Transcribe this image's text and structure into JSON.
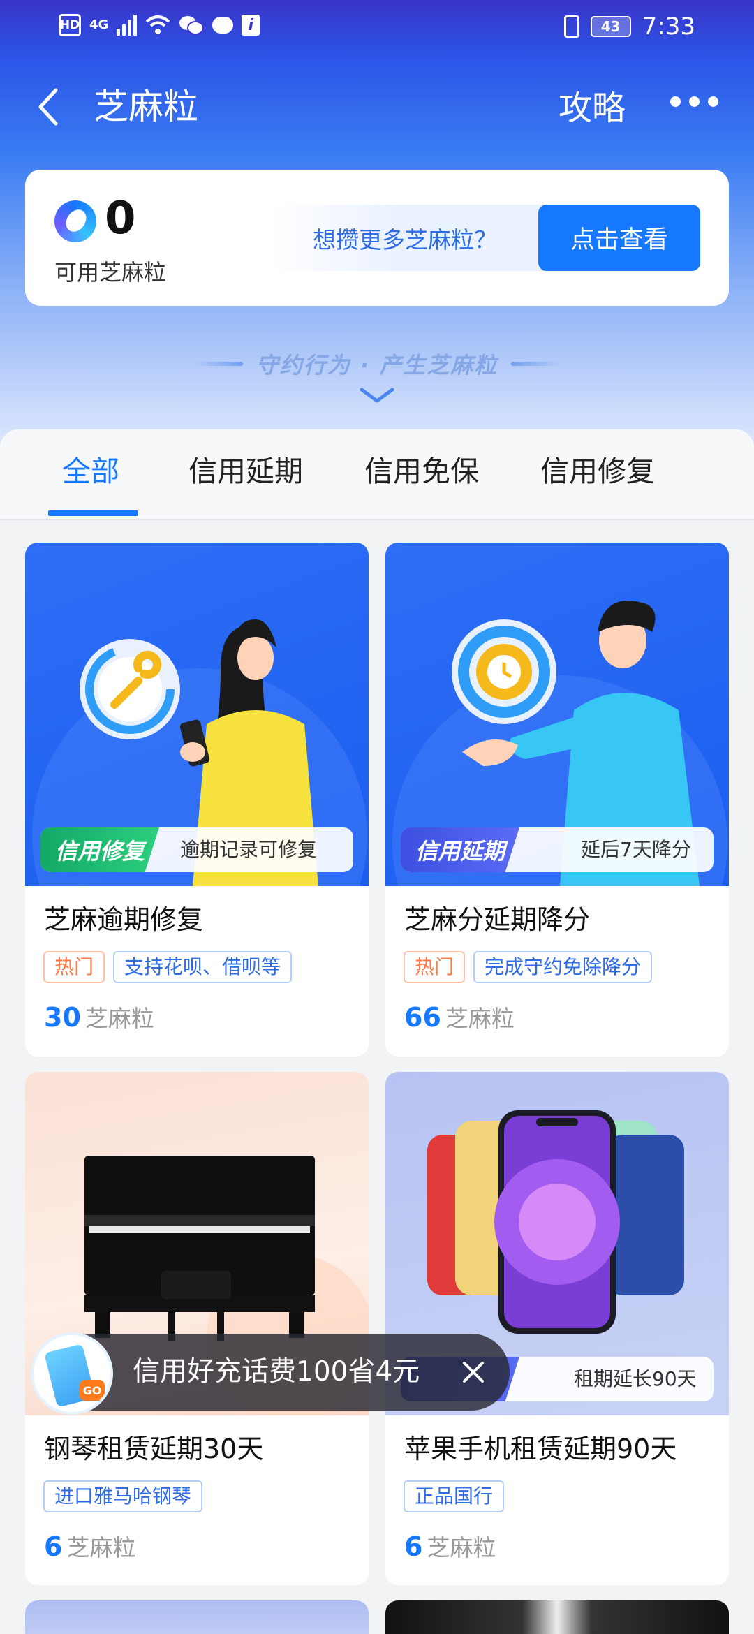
{
  "status_bar": {
    "hd": "HD",
    "network": "4G",
    "battery": "43",
    "time": "7:33",
    "icons": [
      "hd-icon",
      "signal-icon",
      "wifi-icon",
      "wechat-icon",
      "message-icon",
      "info-icon",
      "vibrate-icon",
      "battery-icon"
    ]
  },
  "nav": {
    "back_icon": "chevron-left-icon",
    "title": "芝麻粒",
    "guide": "攻略",
    "more_icon": "more-dots-icon"
  },
  "points_card": {
    "value": "0",
    "label": "可用芝麻粒",
    "promo_text": "想攒更多芝麻粒？",
    "button": "点击查看"
  },
  "slogan": "守约行为 · 产生芝麻粒",
  "tabs": [
    {
      "label": "全部",
      "active": true
    },
    {
      "label": "信用延期",
      "active": false
    },
    {
      "label": "信用免保",
      "active": false
    },
    {
      "label": "信用修复",
      "active": false
    }
  ],
  "cards": [
    {
      "banner_tag": "信用修复",
      "banner_text": "逾期记录可修复",
      "title": "芝麻逾期修复",
      "tags": [
        "热门",
        "支持花呗、借呗等"
      ],
      "points": "30",
      "unit": "芝麻粒"
    },
    {
      "banner_tag": "信用延期",
      "banner_text": "延后7天降分",
      "title": "芝麻分延期降分",
      "tags": [
        "热门",
        "完成守约免除降分"
      ],
      "points": "66",
      "unit": "芝麻粒"
    },
    {
      "title": "钢琴租赁延期30天",
      "tags": [
        "进口雅马哈钢琴"
      ],
      "points": "6",
      "unit": "芝麻粒"
    },
    {
      "banner_text": "租期延长90天",
      "title": "苹果手机租赁延期90天",
      "tags": [
        "正品国行"
      ],
      "points": "6",
      "unit": "芝麻粒"
    }
  ],
  "float_promo": {
    "text": "信用好充话费100省4元",
    "icon_badge": "GO",
    "close_icon": "close-icon"
  },
  "colors": {
    "accent": "#1677ff",
    "hot_tag": "#ff7a45",
    "repair_tag": "#16b26a",
    "delay_tag": "#3d4fe0"
  }
}
